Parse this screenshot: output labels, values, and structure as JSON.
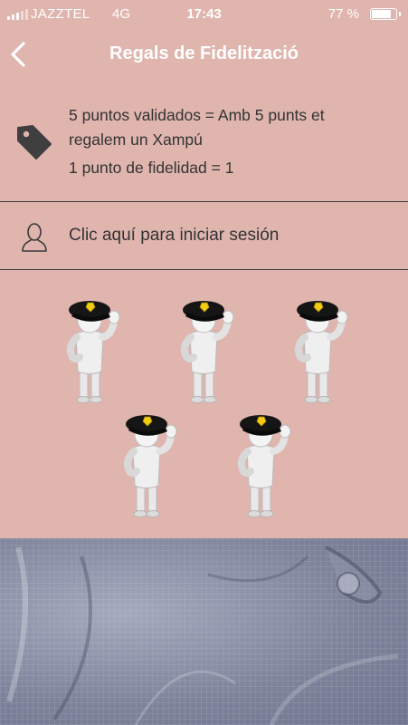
{
  "status_bar": {
    "carrier": "JAZZTEL",
    "network": "4G",
    "time": "17:43",
    "battery": "77 %"
  },
  "nav": {
    "back_icon": "chevron-left-icon",
    "title": "Regals de Fidelització"
  },
  "reward_info": {
    "icon": "price-tag-icon",
    "line1": "5 puntos validados = Amb 5 punts et",
    "line2": "regalem un Xampú",
    "line3": "1 punto de fidelidad = 1"
  },
  "login": {
    "icon": "user-icon",
    "label": "Clic aquí para iniciar sesión"
  },
  "stamps": {
    "count": 5,
    "icon": "police-figure-stamp"
  },
  "colors": {
    "background": "#dfb5ae",
    "text": "#333333",
    "header_text": "#ffffff"
  }
}
